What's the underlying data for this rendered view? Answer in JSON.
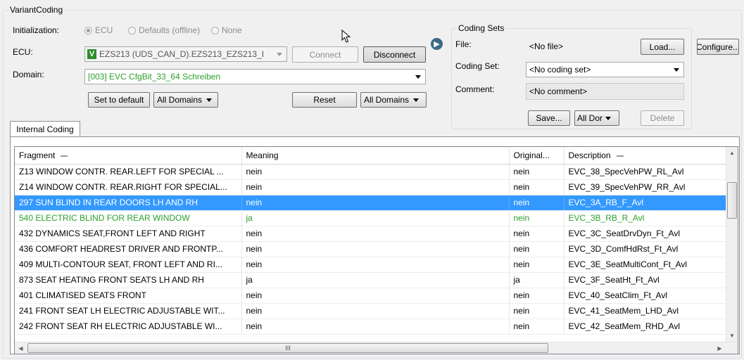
{
  "group_title": "VariantCoding",
  "initialization": {
    "label": "Initialization:",
    "options": [
      {
        "label": "ECU",
        "selected": true
      },
      {
        "label": "Defaults (offline)",
        "selected": false
      },
      {
        "label": "None",
        "selected": false
      }
    ]
  },
  "ecu": {
    "label": "ECU:",
    "badge": "V",
    "value": "EZS213 (UDS_CAN_D).EZS213_EZS213_I",
    "connect_label": "Connect",
    "disconnect_label": "Disconnect"
  },
  "domain": {
    "label": "Domain:",
    "value": "[003] EVC CfgBit_33_64 Schreiben"
  },
  "actions": {
    "set_default_label": "Set to default",
    "all_domains_left": "All Domains",
    "reset_label": "Reset",
    "all_domains_right": "All Domains"
  },
  "coding_sets": {
    "title": "Coding Sets",
    "file_label": "File:",
    "file_value": "<No file>",
    "load_label": "Load...",
    "coding_set_label": "Coding Set:",
    "coding_set_value": "<No coding set>",
    "comment_label": "Comment:",
    "comment_value": "<No comment>",
    "save_label": "Save...",
    "all_dor_label": "All Dor",
    "delete_label": "Delete"
  },
  "configure_label": "Configure...",
  "tab_label": "Internal Coding",
  "table": {
    "columns": [
      "Fragment",
      "Meaning",
      "Original...",
      "Description"
    ],
    "rows": [
      {
        "fragment": "Z13 WINDOW CONTR. REAR.LEFT FOR SPECIAL ...",
        "meaning": "nein",
        "original": "nein",
        "description": "EVC_38_SpecVehPW_RL_Avl"
      },
      {
        "fragment": "Z14 WINDOW CONTR. REAR.RIGHT FOR SPECIAL...",
        "meaning": "nein",
        "original": "nein",
        "description": "EVC_39_SpecVehPW_RR_Avl"
      },
      {
        "fragment": "297 SUN BLIND IN REAR DOORS LH AND RH",
        "meaning": "nein",
        "original": "nein",
        "description": "EVC_3A_RB_F_Avl",
        "state": "selected"
      },
      {
        "fragment": "540 ELECTRIC BLIND FOR REAR WINDOW",
        "meaning": "ja",
        "original": "nein",
        "description": "EVC_3B_RB_R_Avl",
        "state": "changed"
      },
      {
        "fragment": "432 DYNAMICS SEAT,FRONT LEFT AND RIGHT",
        "meaning": "nein",
        "original": "nein",
        "description": "EVC_3C_SeatDrvDyn_Ft_Avl"
      },
      {
        "fragment": "436 COMFORT HEADREST DRIVER AND FRONTP...",
        "meaning": "nein",
        "original": "nein",
        "description": "EVC_3D_ComfHdRst_Ft_Avl"
      },
      {
        "fragment": "409 MULTI-CONTOUR SEAT, FRONT LEFT AND RI...",
        "meaning": "nein",
        "original": "nein",
        "description": "EVC_3E_SeatMultiCont_Ft_Avl"
      },
      {
        "fragment": "873 SEAT HEATING FRONT SEATS LH AND RH",
        "meaning": "ja",
        "original": "ja",
        "description": "EVC_3F_SeatHt_Ft_Avl"
      },
      {
        "fragment": "401 CLIMATISED SEATS FRONT",
        "meaning": "nein",
        "original": "nein",
        "description": "EVC_40_SeatClim_Ft_Avl"
      },
      {
        "fragment": "241 FRONT SEAT LH ELECTRIC ADJUSTABLE WIT...",
        "meaning": "nein",
        "original": "nein",
        "description": "EVC_41_SeatMem_LHD_Avl"
      },
      {
        "fragment": "242 FRONT SEAT RH ELECTRIC ADJUSTABLE WI...",
        "meaning": "nein",
        "original": "nein",
        "description": "EVC_42_SeatMem_RHD_Avl"
      }
    ],
    "scroll_grip": "III"
  },
  "colors": {
    "selection": "#3399ff",
    "changed": "#2ca02c",
    "badge": "#2e8b2e"
  }
}
